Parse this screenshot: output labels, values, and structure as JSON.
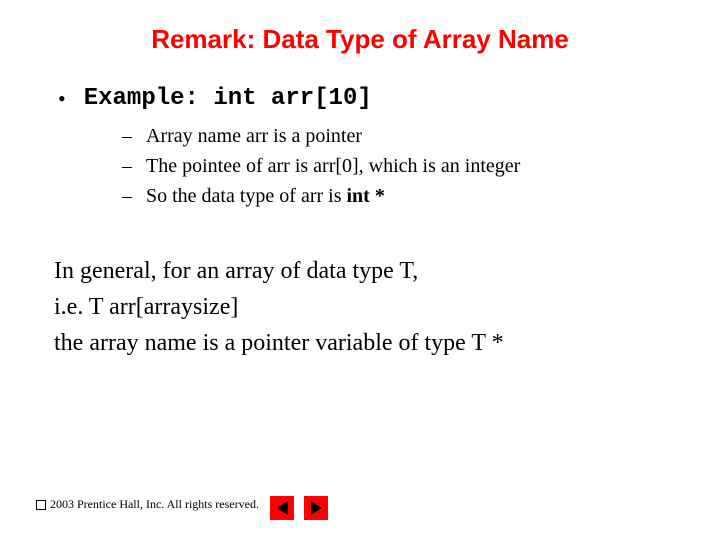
{
  "title": "Remark: Data Type of Array Name",
  "bullet": {
    "label": "Example: int arr[10]",
    "subs": [
      "Array name arr is a pointer",
      "The pointee of arr is arr[0], which is an integer",
      "So the data type of arr is "
    ],
    "sub3_bold": "int *"
  },
  "para": {
    "line1": "In general, for an array of data type T,",
    "line2": "i.e. T arr[arraysize]",
    "line3": "the array name is a pointer variable of type T *"
  },
  "footer": "2003 Prentice Hall, Inc.  All rights reserved."
}
